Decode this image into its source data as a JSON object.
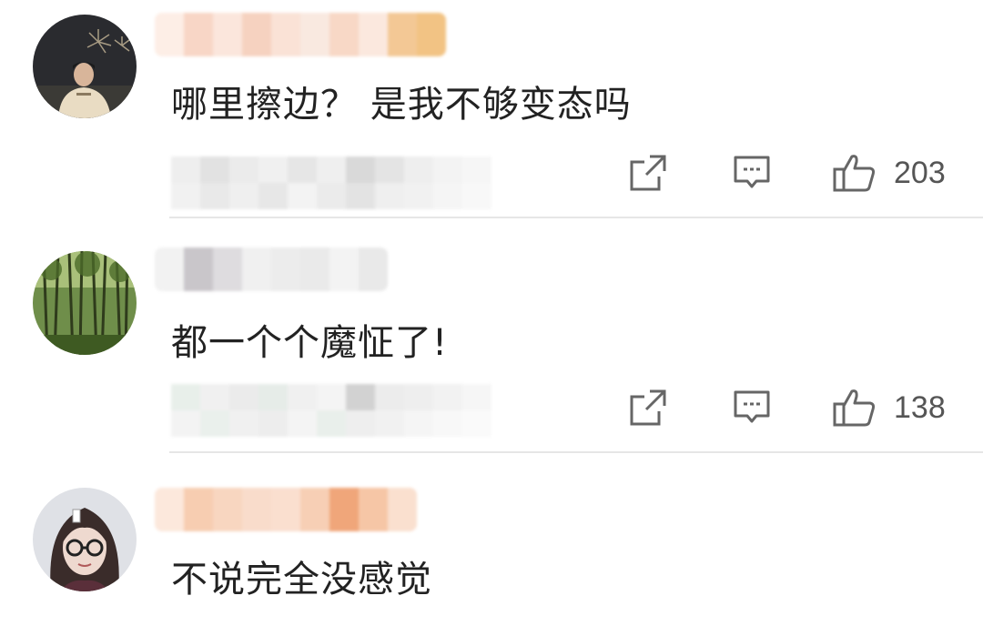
{
  "comments": [
    {
      "text": "哪里擦边？ 是我不够变态吗",
      "likes": "203",
      "avatar_icon": "night-fireworks-person-avatar"
    },
    {
      "text": "都一个个魔怔了!",
      "likes": "138",
      "avatar_icon": "bamboo-forest-avatar"
    },
    {
      "text": "不说完全没感觉",
      "avatar_icon": "woman-glasses-avatar"
    }
  ],
  "icons": {
    "share": "share-icon",
    "comment": "comment-icon",
    "like": "thumbs-up-icon"
  },
  "colors": {
    "text": "#222222",
    "icon": "#666666",
    "divider": "#e6e6e6"
  }
}
